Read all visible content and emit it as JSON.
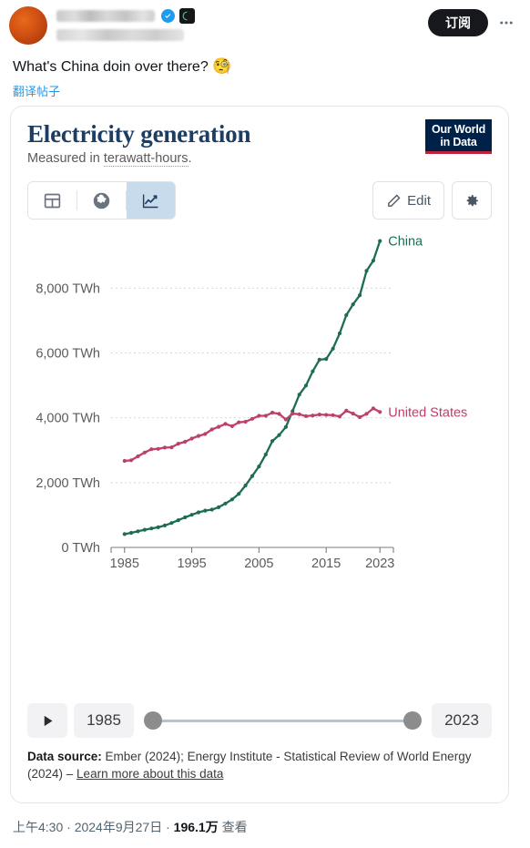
{
  "post": {
    "author_name_redacted": true,
    "verified_icon": "verified-badge-icon",
    "affiliate_icon": "affiliate-badge-icon",
    "subscribe_label": "订阅",
    "more_icon": "more-options-icon",
    "text": "What's China doin over there?",
    "emoji": "🧐",
    "translate_label": "翻译帖子",
    "footer_time": "上午4:30",
    "footer_sep1": "·",
    "footer_date": "2024年9月27日",
    "footer_sep2": "·",
    "footer_views_count": "196.1万",
    "footer_views_label": "查看"
  },
  "chart": {
    "title": "Electricity generation",
    "subtitle_prefix": "Measured in ",
    "subtitle_underlined": "terawatt-hours",
    "subtitle_suffix": ".",
    "logo_line1": "Our World",
    "logo_line2": "in Data",
    "tabs": [
      {
        "name": "table-tab",
        "icon": "table-icon",
        "active": false
      },
      {
        "name": "map-tab",
        "icon": "globe-icon",
        "active": false
      },
      {
        "name": "chart-tab",
        "icon": "line-chart-icon",
        "active": true
      }
    ],
    "edit_label": "Edit",
    "edit_icon": "pencil-icon",
    "settings_icon": "gear-icon",
    "timeline": {
      "play_icon": "play-icon",
      "start_year": "1985",
      "end_year": "2023"
    },
    "source": {
      "label": "Data source:",
      "text": " Ember (2024); Energy Institute - Statistical Review of World Energy (2024) – ",
      "link": "Learn more about this data"
    }
  },
  "chart_data": {
    "type": "line",
    "title": "Electricity generation",
    "subtitle": "Measured in terawatt-hours.",
    "xlabel": "",
    "ylabel": "TWh",
    "xlim": [
      1983,
      2025
    ],
    "ylim": [
      0,
      9500
    ],
    "grid": "horizontal-dotted",
    "legend_position": "end-of-line-labels",
    "y_ticks": [
      0,
      2000,
      4000,
      6000,
      8000
    ],
    "y_tick_labels": [
      "0 TWh",
      "2,000 TWh",
      "4,000 TWh",
      "6,000 TWh",
      "8,000 TWh"
    ],
    "x_ticks": [
      1985,
      1995,
      2005,
      2015,
      2023
    ],
    "x_tick_labels": [
      "1985",
      "1995",
      "2005",
      "2015",
      "2023"
    ],
    "x": [
      1985,
      1986,
      1987,
      1988,
      1989,
      1990,
      1991,
      1992,
      1993,
      1994,
      1995,
      1996,
      1997,
      1998,
      1999,
      2000,
      2001,
      2002,
      2003,
      2004,
      2005,
      2006,
      2007,
      2008,
      2009,
      2010,
      2011,
      2012,
      2013,
      2014,
      2015,
      2016,
      2017,
      2018,
      2019,
      2020,
      2021,
      2022,
      2023
    ],
    "series": [
      {
        "name": "China",
        "color": "#1c6e4f",
        "label": "China",
        "values": [
          411,
          450,
          497,
          545,
          585,
          621,
          678,
          754,
          839,
          928,
          1007,
          1081,
          1136,
          1167,
          1239,
          1356,
          1481,
          1654,
          1911,
          2203,
          2500,
          2866,
          3282,
          3466,
          3715,
          4207,
          4715,
          4994,
          5432,
          5794,
          5814,
          6133,
          6604,
          7166,
          7503,
          7779,
          8534,
          8849,
          9456
        ]
      },
      {
        "name": "United States",
        "color": "#bc4069",
        "label": "United States",
        "values": [
          2670,
          2690,
          2810,
          2930,
          3030,
          3040,
          3080,
          3090,
          3200,
          3260,
          3360,
          3440,
          3500,
          3640,
          3720,
          3810,
          3740,
          3860,
          3880,
          3970,
          4060,
          4060,
          4160,
          4120,
          3950,
          4130,
          4110,
          4050,
          4070,
          4100,
          4090,
          4080,
          4040,
          4220,
          4130,
          4020,
          4120,
          4290,
          4180
        ]
      }
    ]
  }
}
